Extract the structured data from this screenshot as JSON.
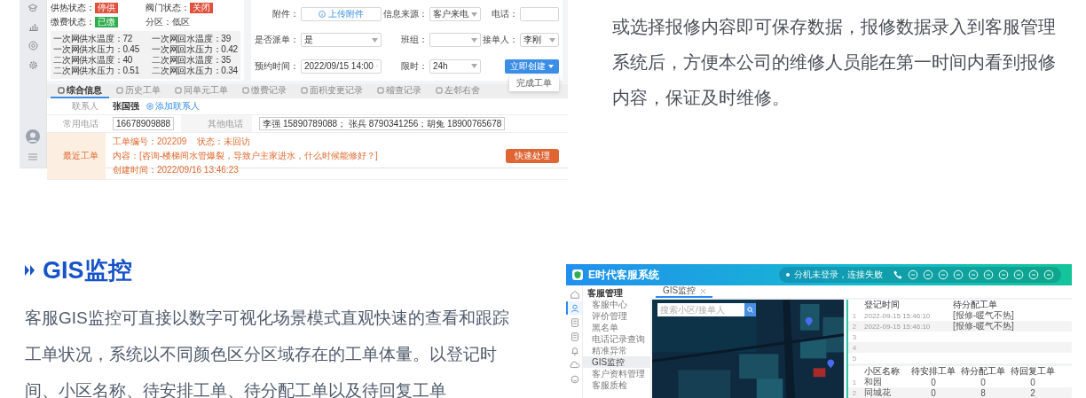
{
  "top_screenshot": {
    "statuses": [
      {
        "label": "供热状态：",
        "value": "停供",
        "color": "#e0503c"
      },
      {
        "label": "阀门状态：",
        "value": "关闭",
        "color": "#e0503c"
      },
      {
        "label": "缴费状态：",
        "value": "已缴",
        "color": "#2eae4e"
      }
    ],
    "district": {
      "label": "分区：",
      "value": "低区"
    },
    "metrics": [
      "一次网供水温度：72",
      "一次网回水温度：39",
      "一次网供水压力：0.45",
      "一次网回水压力：0.42",
      "二次网供水温度：40",
      "二次网回水温度：35",
      "二次网供水压力：0.51",
      "二次网回水压力：0.34"
    ],
    "form": [
      {
        "label": "附件：",
        "kind": "upload",
        "value": "上传附件"
      },
      {
        "label": "信息来源：",
        "kind": "select",
        "value": "客户来电"
      },
      {
        "label": "电话：",
        "kind": "input"
      },
      {
        "label": "是否派单：",
        "kind": "select",
        "value": "是"
      },
      {
        "label": "班组：",
        "kind": "select"
      },
      {
        "label": "接单人：",
        "kind": "select",
        "value": "李刚"
      },
      {
        "label": "预约时间：",
        "kind": "date",
        "value": "2022/09/15 14:00"
      },
      {
        "label": "限时：",
        "kind": "select",
        "value": "24h"
      }
    ],
    "create_button": {
      "label": "立即创建",
      "menu": [
        "完成工单"
      ]
    },
    "tabs": [
      {
        "label": "综合信息",
        "selected": true
      },
      {
        "label": "历史工单",
        "selected": false
      },
      {
        "label": "同单元工单",
        "selected": false
      },
      {
        "label": "缴费记录",
        "selected": false
      },
      {
        "label": "面积变更记录",
        "selected": false
      },
      {
        "label": "稽查记录",
        "selected": false
      },
      {
        "label": "左邻右舍",
        "selected": false
      }
    ],
    "contact": {
      "label": "联系人",
      "value": "张国强",
      "add_link": "添加联系人"
    },
    "phones": {
      "label": "常用电话",
      "value": "16678909888",
      "other_label": "其他电话",
      "other_value": "李强 15890789088； 张兵 8790341256；胡兔 18900765678"
    },
    "recent": {
      "label": "最近工单",
      "items": [
        "工单编号：202209",
        "状态：未回访",
        "内容：[咨询-楼梯间水管爆裂，导致户主家进水，什么时候能修好？]",
        "创建时间：2022/09/16 13:46:23"
      ],
      "button": "快速处理"
    }
  },
  "intro_text": "或选择报修内容即可保存数据，报修数据录入到客服管理系统后，方便本公司的维修人员能在第一时间内看到报修内容，保证及时维修。",
  "gis": {
    "title": "GIS监控",
    "description": "客服GIS监控可直接以数字可视化场景模式直观快速的查看和跟踪工单状况，系统以不同颜色区分区域存在的工单体量。以登记时间、小区名称、待安排工单、待分配工单以及待回复工单"
  },
  "gis_screenshot": {
    "app_title": "E时代客服系统",
    "connection_status": "分机未登录，连接失败",
    "rail": [
      {
        "kind": "home",
        "selected": false
      },
      {
        "kind": "user",
        "selected": true
      },
      {
        "kind": "doc",
        "selected": false
      },
      {
        "kind": "doc",
        "selected": false
      },
      {
        "kind": "bell",
        "selected": false
      },
      {
        "kind": "cloud",
        "selected": false
      },
      {
        "kind": "smile",
        "selected": false
      }
    ],
    "menu_title": "客服管理",
    "menu": [
      {
        "label": "客服中心",
        "selected": false
      },
      {
        "label": "评价管理",
        "selected": false
      },
      {
        "label": "黑名单",
        "selected": false
      },
      {
        "label": "电话记录查询",
        "selected": false
      },
      {
        "label": "精准异常",
        "selected": false
      },
      {
        "label": "GIS监控",
        "selected": true
      },
      {
        "label": "客户资料管理",
        "selected": false
      },
      {
        "label": "客服质检",
        "selected": false
      }
    ],
    "tab": "GIS监控",
    "search": {
      "placeholder": "搜索小区/接单人"
    },
    "orders_table": {
      "columns": [
        "登记时间",
        "待分配工单"
      ],
      "rows": [
        {
          "index": "1",
          "time": "2022-09-15 15:46:10",
          "content": "[报修-暖气不热]"
        },
        {
          "index": "2",
          "time": "2022-09-15 15:46:10",
          "content": "[报修-暖气不热]"
        },
        {
          "index": "3"
        },
        {
          "index": "4"
        },
        {
          "index": "5"
        }
      ]
    },
    "area_table": {
      "columns": [
        "小区名称",
        "待安排工单",
        "待分配工单",
        "待回复工单"
      ],
      "rows": [
        {
          "index": "1",
          "cells": [
            "和园",
            "0",
            "0",
            "0"
          ]
        },
        {
          "index": "2",
          "cells": [
            "同城花",
            "0",
            "8",
            "2"
          ]
        }
      ]
    }
  }
}
